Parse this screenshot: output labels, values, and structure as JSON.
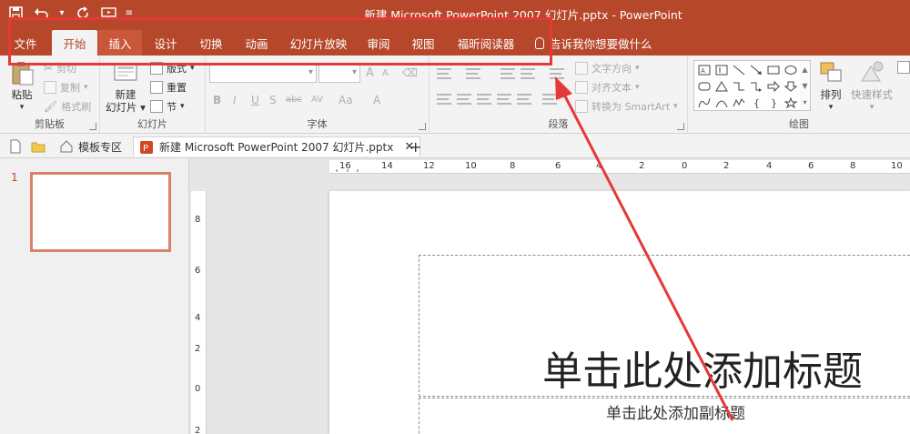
{
  "window": {
    "title": "新建 Microsoft PowerPoint 2007 幻灯片.pptx  -  PowerPoint",
    "qat": {
      "save_icon": "save-icon",
      "undo_icon": "undo-icon",
      "redo_icon": "redo-icon",
      "slideshow_icon": "start-slideshow-icon",
      "customize_icon": "customize-qat-icon"
    }
  },
  "ribbon": {
    "tabs": [
      {
        "label": "文件"
      },
      {
        "label": "开始"
      },
      {
        "label": "插入"
      },
      {
        "label": "设计"
      },
      {
        "label": "切换"
      },
      {
        "label": "动画"
      },
      {
        "label": "幻灯片放映"
      },
      {
        "label": "审阅"
      },
      {
        "label": "视图"
      },
      {
        "label": "福昕阅读器"
      }
    ],
    "active_tab": "开始",
    "hovered_tab": "插入",
    "tell_me": "告诉我你想要做什么",
    "groups": {
      "clipboard": {
        "label": "剪贴板",
        "paste": "粘贴",
        "cut": "剪切",
        "copy": "复制",
        "format_painter": "格式刷"
      },
      "slides": {
        "label": "幻灯片",
        "new_slide_line1": "新建",
        "new_slide_line2": "幻灯片",
        "layout": "版式",
        "reset": "重置",
        "section": "节"
      },
      "font": {
        "label": "字体",
        "bold": "B",
        "italic": "I",
        "underline": "U",
        "shadow": "S",
        "strikethrough": "abc",
        "spacing": "AV",
        "case": "Aa",
        "grow": "A",
        "shrink": "A"
      },
      "paragraph": {
        "label": "段落",
        "text_direction": "文字方向",
        "align_text": "对齐文本",
        "convert_smartart": "转换为 SmartArt"
      },
      "drawing": {
        "label": "绘图",
        "arrange": "排列",
        "quick_styles": "快速样式"
      }
    }
  },
  "document_tabs": [
    {
      "label": "模板专区",
      "icon": "home-icon"
    },
    {
      "label": "新建 Microsoft PowerPoint 2007 幻灯片.pptx",
      "icon": "powerpoint-file-icon"
    }
  ],
  "thumbnails": [
    {
      "number": "1"
    }
  ],
  "rulers": {
    "horizontal": [
      "16",
      "14",
      "12",
      "10",
      "8",
      "6",
      "4",
      "2",
      "0",
      "2",
      "4",
      "6",
      "8",
      "10"
    ],
    "vertical": [
      "8",
      "6",
      "4",
      "2",
      "0",
      "2"
    ]
  },
  "slide": {
    "title_placeholder": "单击此处添加标题",
    "subtitle_placeholder": "单击此处添加副标题"
  },
  "colors": {
    "accent": "#b7472a",
    "annotation": "#e53935"
  }
}
